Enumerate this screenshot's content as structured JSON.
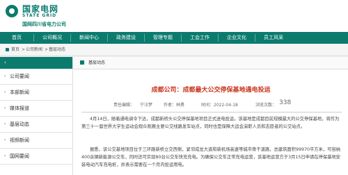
{
  "logo": {
    "cn": "国家电网",
    "en": "STATE GRID",
    "sub": "国网四川省电力公司"
  },
  "nav": [
    "首页",
    "公司概况",
    "新闻中心",
    "政务建设",
    "管理专题",
    "工会工作",
    "企业文化",
    "员工风采"
  ],
  "breadcrumb": [
    "首页",
    "公司新闻",
    "基层动态"
  ],
  "sidebar": {
    "items": [
      "公司要闻",
      "本部新闻",
      "媒体报道",
      "基层动态",
      "视频新闻",
      "国网要闻"
    ]
  },
  "main": {
    "section": "基层动态",
    "title": "成都公司：成都最大公交停保基地通电投运",
    "meta": {
      "editor": "责任编辑：",
      "author": "作者：林勇",
      "date": "时间：2022-04-18",
      "views": "浏览次数：",
      "count": "338",
      "reporter": "宁汪梦"
    },
    "paragraphs": [
      "4月14日，随着通电调令下达，成都新桥头公交停保基地项目正式送电投运。该基地是成都目前规模最大的公交停保基地，将作为第三十一届世界大学生运动会观众观赛主要公交线路发车站点，同时也是保障大运会演职人员和志愿者的公交站点。",
      "据悉，该公交基地项目位于三环路新桥立交西侧，紧邻成龙大道和新机场高速等城市骨干道路，总建筑面积99970平方米，可容纳400余辆新能源公交车，同时还可实现80台公交车快充充电。为确保公交车正常充电运营，该基地运营方于3月15日申请在停保基地安装电动汽车充电桩，并表示需要在一个月内投运用电。"
    ]
  },
  "colors": {
    "brand": "#0b7b6e",
    "title": "#c8361e"
  }
}
